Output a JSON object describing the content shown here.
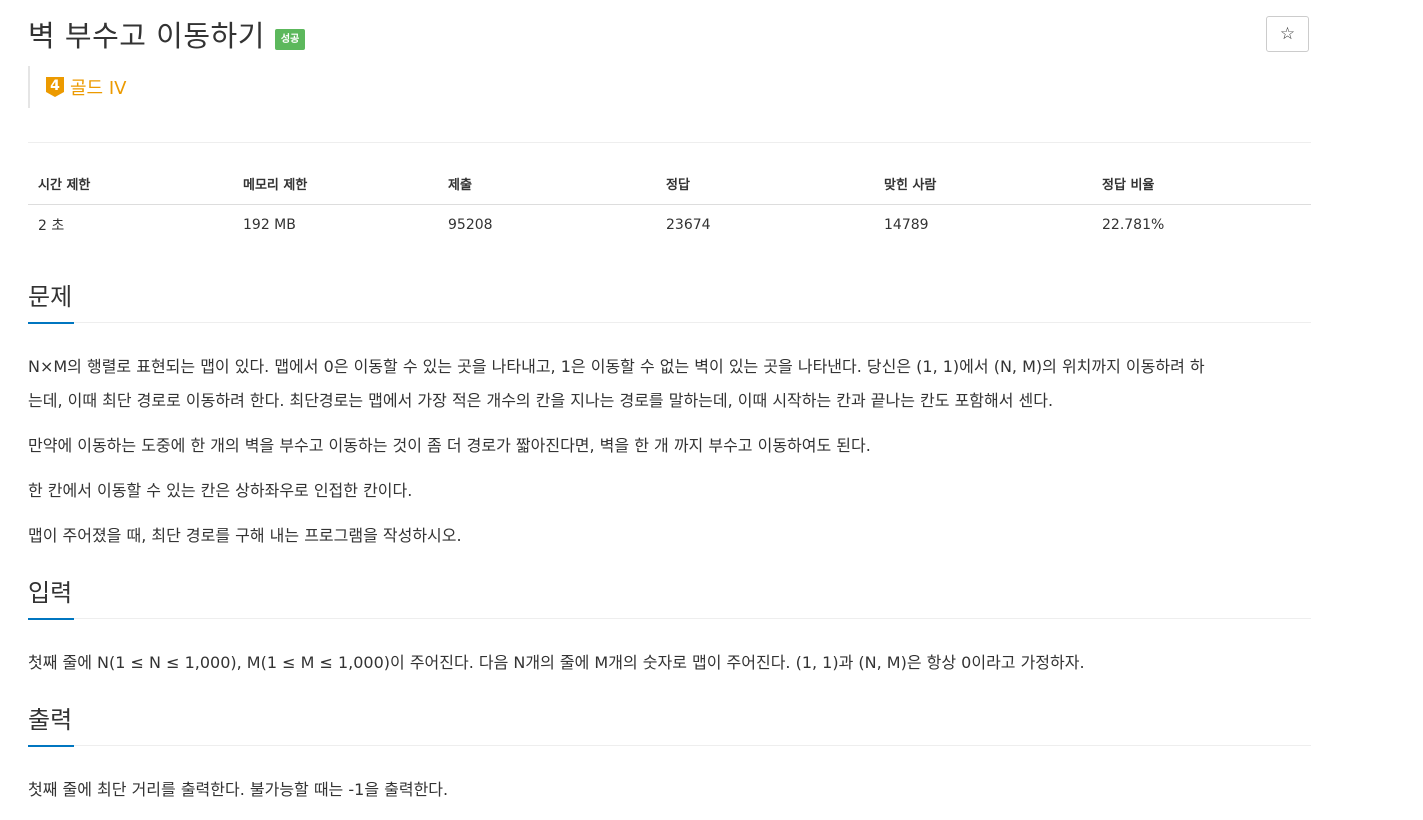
{
  "problem": {
    "title": "벽 부수고 이동하기",
    "status_badge": "성공",
    "tier_number": "4",
    "tier_label": "골드 IV",
    "star_label": "☆"
  },
  "info_table": {
    "headers": [
      "시간 제한",
      "메모리 제한",
      "제출",
      "정답",
      "맞힌 사람",
      "정답 비율"
    ],
    "values": [
      "2 초",
      "192 MB",
      "95208",
      "23674",
      "14789",
      "22.781%"
    ]
  },
  "description": {
    "heading": "문제",
    "paragraphs": [
      "N×M의 행렬로 표현되는 맵이 있다. 맵에서 0은 이동할 수 있는 곳을 나타내고, 1은 이동할 수 없는 벽이 있는 곳을 나타낸다. 당신은 (1, 1)에서 (N, M)의 위치까지 이동하려 하",
      "는데, 이때 최단 경로로 이동하려 한다. 최단경로는 맵에서 가장 적은 개수의 칸을 지나는 경로를 말하는데, 이때 시작하는 칸과 끝나는 칸도 포함해서 센다.",
      "만약에 이동하는 도중에 한 개의 벽을 부수고 이동하는 것이 좀 더 경로가 짧아진다면, 벽을 한 개 까지 부수고 이동하여도 된다.",
      "한 칸에서 이동할 수 있는 칸은 상하좌우로 인접한 칸이다.",
      "맵이 주어졌을 때, 최단 경로를 구해 내는 프로그램을 작성하시오."
    ]
  },
  "input": {
    "heading": "입력",
    "paragraphs": [
      "첫째 줄에 N(1 ≤ N ≤ 1,000), M(1 ≤ M ≤ 1,000)이 주어진다. 다음 N개의 줄에 M개의 숫자로 맵이 주어진다. (1, 1)과 (N, M)은 항상 0이라고 가정하자."
    ]
  },
  "output": {
    "heading": "출력",
    "paragraphs": [
      "첫째 줄에 최단 거리를 출력한다. 불가능할 때는 -1을 출력한다."
    ]
  },
  "colors": {
    "success_badge": "#5cb85c",
    "tier_gold": "#ec9a00",
    "section_underline": "#0076c0"
  },
  "icons": {
    "tier": "gold-tier-icon",
    "star": "star-outline-icon"
  }
}
